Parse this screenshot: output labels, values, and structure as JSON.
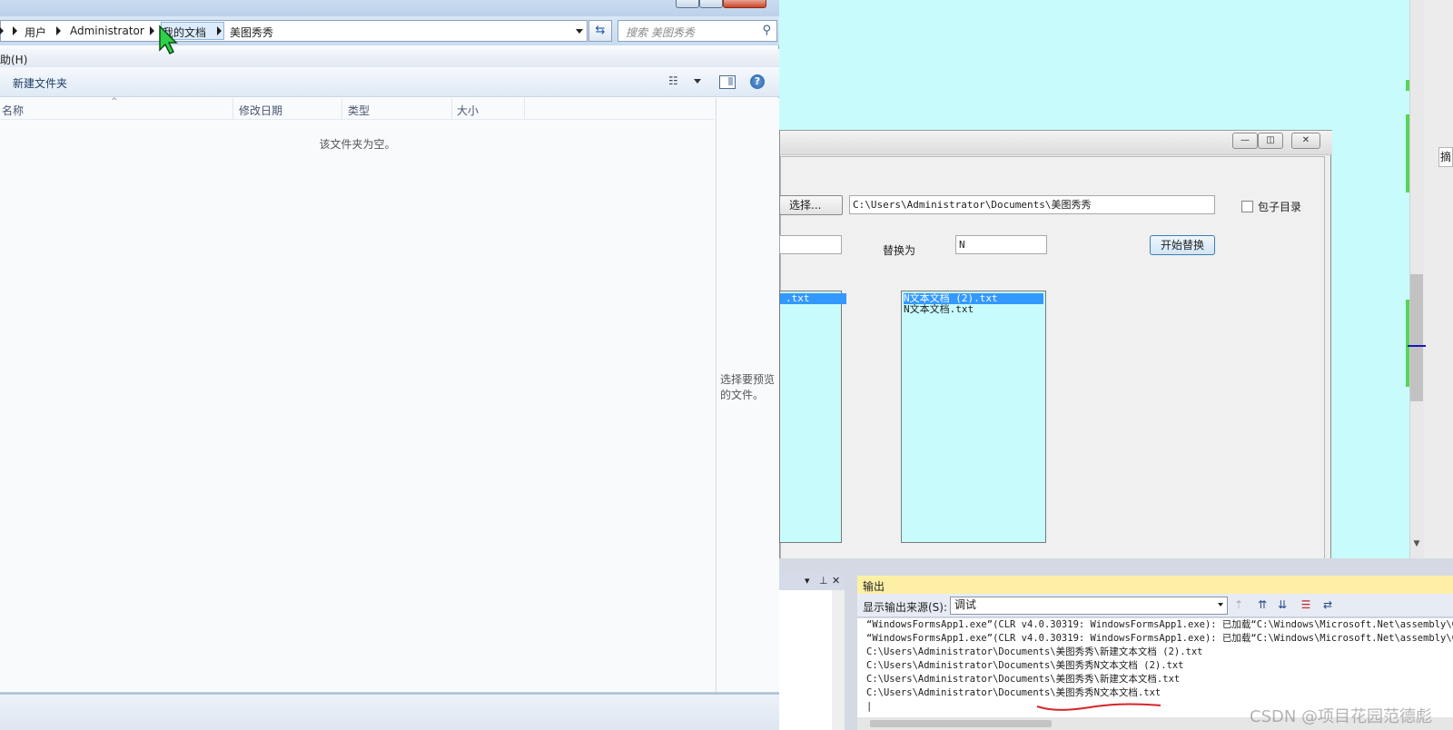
{
  "explorer": {
    "breadcrumbs": [
      "用户",
      "Administrator",
      "我的文档",
      "美图秀秀"
    ],
    "search_placeholder": "搜索 美图秀秀",
    "menu_partial": "助(H)",
    "toolbar_new_folder": "新建文件夹",
    "columns": [
      "名称",
      "修改日期",
      "类型",
      "大小"
    ],
    "empty_message": "该文件夹为空。",
    "preview_message": "选择要预览的文件。"
  },
  "form": {
    "choose_button": "选择...",
    "path_value": "C:\\Users\\Administrator\\Documents\\美图秀秀",
    "include_subdir_label": "包子目录",
    "include_subdir_checked": false,
    "replace_with_label": "替换为",
    "replace_with_value": "N",
    "start_button": "开始替换",
    "left_list_items": [
      ".txt"
    ],
    "right_list_items": [
      "N文本文档 (2).txt",
      "N文本文档.txt"
    ],
    "right_list_selected_index": 0
  },
  "output": {
    "title": "输出",
    "source_label": "显示输出来源(S):",
    "source_value": "调试",
    "lines": [
      "“WindowsFormsApp1.exe”(CLR v4.0.30319: WindowsFormsApp1.exe): 已加载“C:\\Windows\\Microsoft.Net\\assembly\\GA",
      "“WindowsFormsApp1.exe”(CLR v4.0.30319: WindowsFormsApp1.exe): 已加载“C:\\Windows\\Microsoft.Net\\assembly\\GA",
      "C:\\Users\\Administrator\\Documents\\美图秀秀\\新建文本文档 (2).txt",
      "C:\\Users\\Administrator\\Documents\\美图秀秀N文本文档 (2).txt",
      "C:\\Users\\Administrator\\Documents\\美图秀秀\\新建文本文档.txt",
      "C:\\Users\\Administrator\\Documents\\美图秀秀N文本文档.txt",
      "|"
    ]
  },
  "right_panel_tab": "摘",
  "watermark": "CSDN @项目花园范德彪",
  "colors": {
    "form_list_bg": "#c8fcfc",
    "selection": "#3399ff",
    "output_header": "#fdf0a6"
  }
}
